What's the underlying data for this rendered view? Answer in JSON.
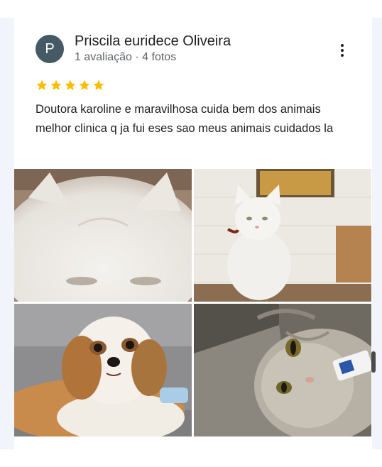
{
  "review": {
    "avatar_letter": "P",
    "author_name": "Priscila euridece Oliveira",
    "author_meta": "1 avaliação · 4 fotos",
    "rating": 5,
    "text": "Doutora karoline e maravilhosa cuida bem dos animais melhor clinica q ja fui eses sao meus animais cuidados la"
  },
  "icons": {
    "more": "more-vert-icon",
    "star": "star-icon"
  },
  "colors": {
    "avatar_bg": "#455a64",
    "star": "#fbbc04"
  },
  "photos": [
    {
      "subject": "white fluffy cat close-up"
    },
    {
      "subject": "white cat sitting by wall"
    },
    {
      "subject": "shih tzu dog lying on couch"
    },
    {
      "subject": "gray tabby cat lying down"
    }
  ]
}
